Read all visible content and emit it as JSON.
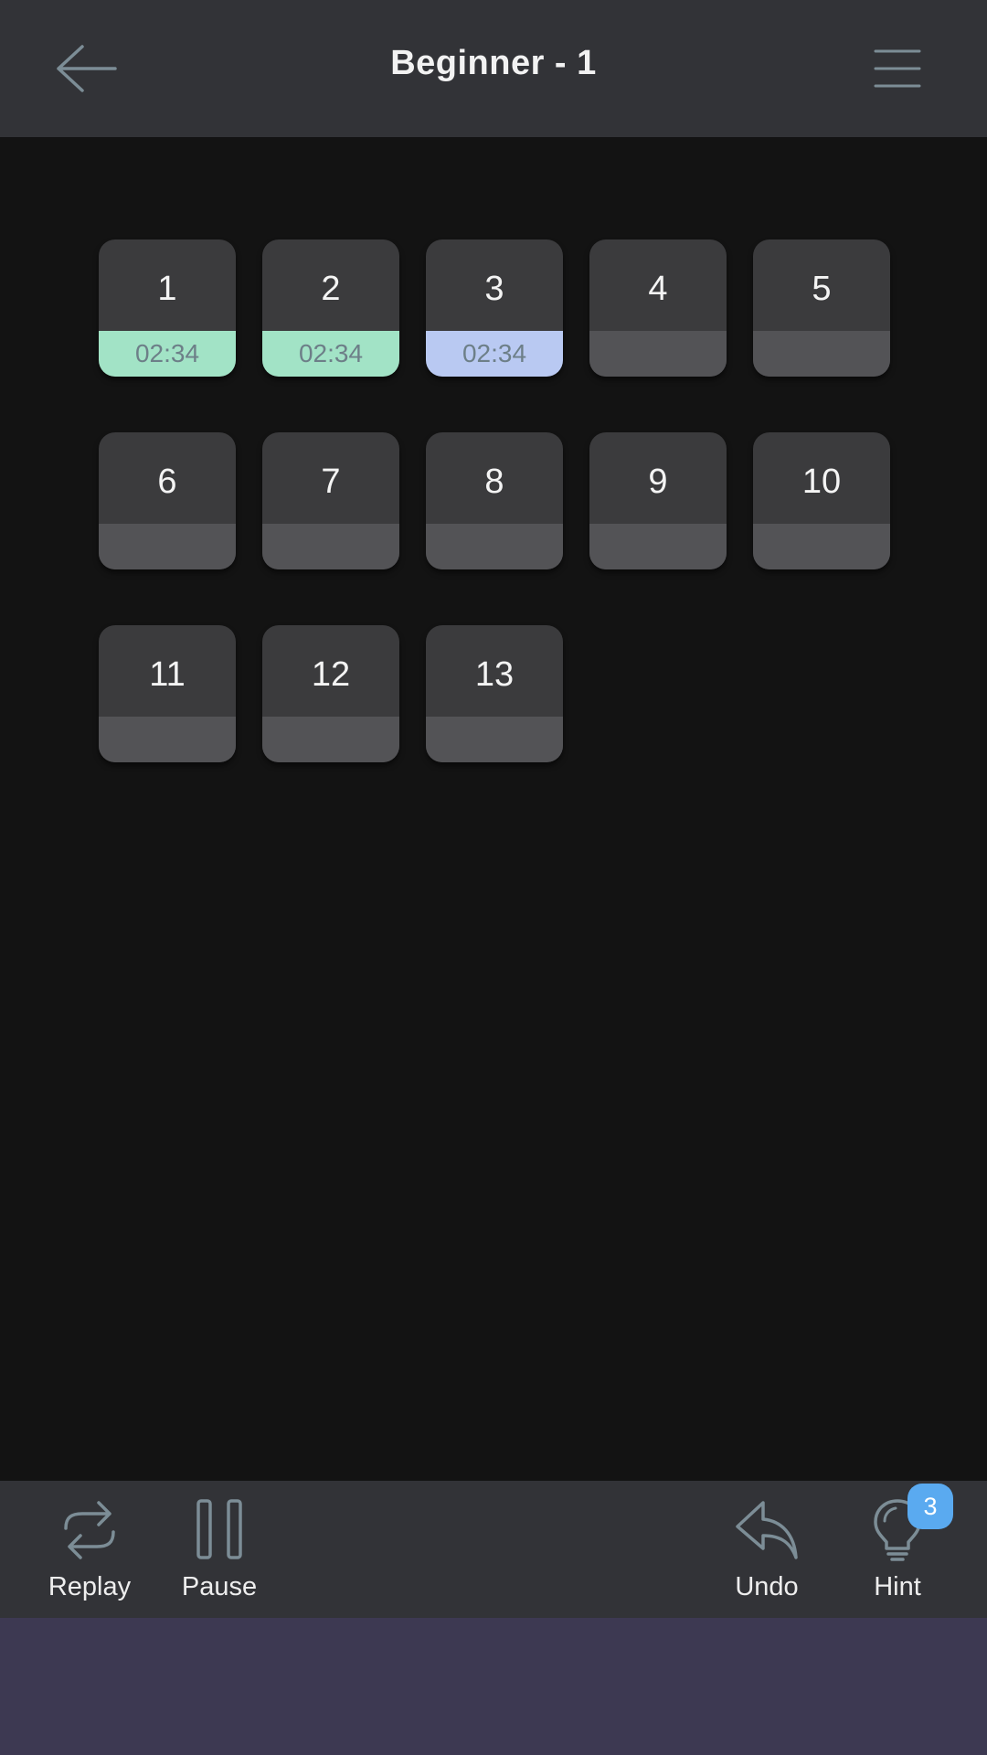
{
  "header": {
    "title": "Beginner - 1",
    "back_icon": "arrow-left-icon",
    "menu_icon": "hamburger-menu-icon"
  },
  "levels": [
    {
      "number": "1",
      "time": "02:34",
      "status": "completed"
    },
    {
      "number": "2",
      "time": "02:34",
      "status": "completed"
    },
    {
      "number": "3",
      "time": "02:34",
      "status": "current"
    },
    {
      "number": "4",
      "time": "",
      "status": "locked"
    },
    {
      "number": "5",
      "time": "",
      "status": "locked"
    },
    {
      "number": "6",
      "time": "",
      "status": "locked"
    },
    {
      "number": "7",
      "time": "",
      "status": "locked"
    },
    {
      "number": "8",
      "time": "",
      "status": "locked"
    },
    {
      "number": "9",
      "time": "",
      "status": "locked"
    },
    {
      "number": "10",
      "time": "",
      "status": "locked"
    },
    {
      "number": "11",
      "time": "",
      "status": "locked"
    },
    {
      "number": "12",
      "time": "",
      "status": "locked"
    },
    {
      "number": "13",
      "time": "",
      "status": "locked"
    }
  ],
  "toolbar": {
    "replay_label": "Replay",
    "pause_label": "Pause",
    "undo_label": "Undo",
    "hint_label": "Hint",
    "hint_count": "3"
  },
  "colors": {
    "completed": "#a2e3c6",
    "current": "#b9c9f2",
    "locked": "#535356",
    "badge": "#5aaaf0"
  }
}
